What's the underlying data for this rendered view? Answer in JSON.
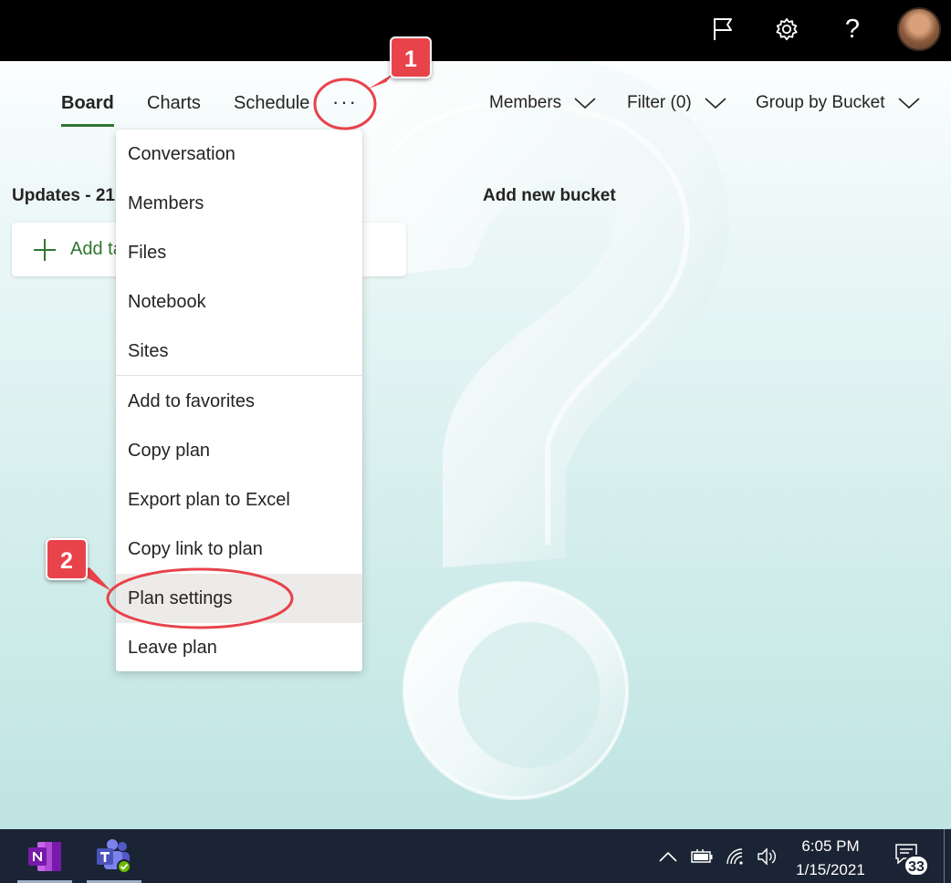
{
  "topbar": {
    "icons": [
      "flag-icon",
      "gear-icon",
      "help-icon",
      "avatar"
    ],
    "help_glyph": "?"
  },
  "nav": {
    "tabs": [
      {
        "label": "Board",
        "active": true
      },
      {
        "label": "Charts",
        "active": false
      },
      {
        "label": "Schedule",
        "active": false
      }
    ],
    "more_label": "···",
    "members_label": "Members",
    "filter_label": "Filter (0)",
    "group_label": "Group by Bucket"
  },
  "board": {
    "bucket_title": "Updates - 21",
    "add_task_label": "Add task",
    "add_bucket_label": "Add new bucket"
  },
  "menu": {
    "items": [
      {
        "label": "Conversation"
      },
      {
        "label": "Members"
      },
      {
        "label": "Files"
      },
      {
        "label": "Notebook"
      },
      {
        "label": "Sites"
      },
      {
        "label": "Add to favorites"
      },
      {
        "label": "Copy plan"
      },
      {
        "label": "Export plan to Excel"
      },
      {
        "label": "Copy link to plan"
      },
      {
        "label": "Plan settings",
        "highlighted": true
      },
      {
        "label": "Leave plan"
      }
    ]
  },
  "callouts": {
    "step1": "1",
    "step2": "2",
    "color": "#e8434b"
  },
  "taskbar": {
    "apps": [
      "onenote-icon",
      "teams-icon"
    ],
    "time": "6:05 PM",
    "date": "1/15/2021",
    "notification_count": "33",
    "colors": {
      "background": "#1b2434"
    }
  },
  "colors": {
    "accent": "#31752f",
    "menu_hover": "#edebe9"
  }
}
